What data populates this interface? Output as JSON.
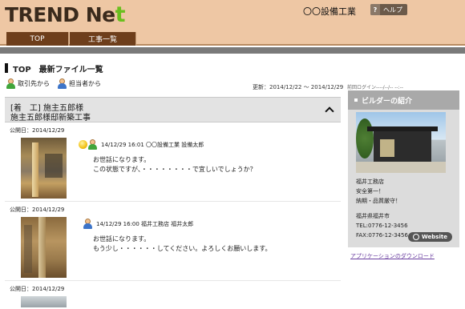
{
  "header": {
    "logo_text": "TREND Ne",
    "logo_plus": "t",
    "company": "〇〇設備工業",
    "help_label": "ヘルプ"
  },
  "nav": {
    "tabs": [
      "TOP",
      "工事一覧"
    ]
  },
  "page": {
    "title": "TOP　最新ファイル一覧"
  },
  "filters": {
    "by_client": "取引先から",
    "by_person": "担当者から",
    "updated": "更新：2014/12/22 〜 2014/12/29"
  },
  "thread": {
    "line1": "[着　工] 施主五郎様",
    "line2": "施主五郎様邸新築工事"
  },
  "posts": [
    {
      "date": "公開日：2014/12/29",
      "meta": "14/12/29 16:01 〇〇設備工業 設備太郎",
      "line1": "お世話になります。",
      "line2": "この状態ですが、・・・・・・・・で宜しいでしょうか？"
    },
    {
      "date": "公開日：2014/12/29",
      "meta": "14/12/29 16:00 福井工務店 福井太郎",
      "line1": "お世話になります。",
      "line2": "もう少し・・・・・・してください。よろしくお願いします。"
    },
    {
      "date": "公開日：2014/12/29"
    }
  ],
  "sidebar": {
    "last_login": "前回ログイン----/--/-- --:--",
    "builder_title": "ビルダーの紹介",
    "builder_name": "福井工務店",
    "tag1": "安全第一！",
    "tag2": "納期・品質厳守！",
    "location": "福井県福井市",
    "tel": "TEL:0776-12-3456",
    "fax": "FAX:0776-12-3456",
    "website_button": "Website",
    "app_link": "アプリケーションのダウンロード"
  }
}
